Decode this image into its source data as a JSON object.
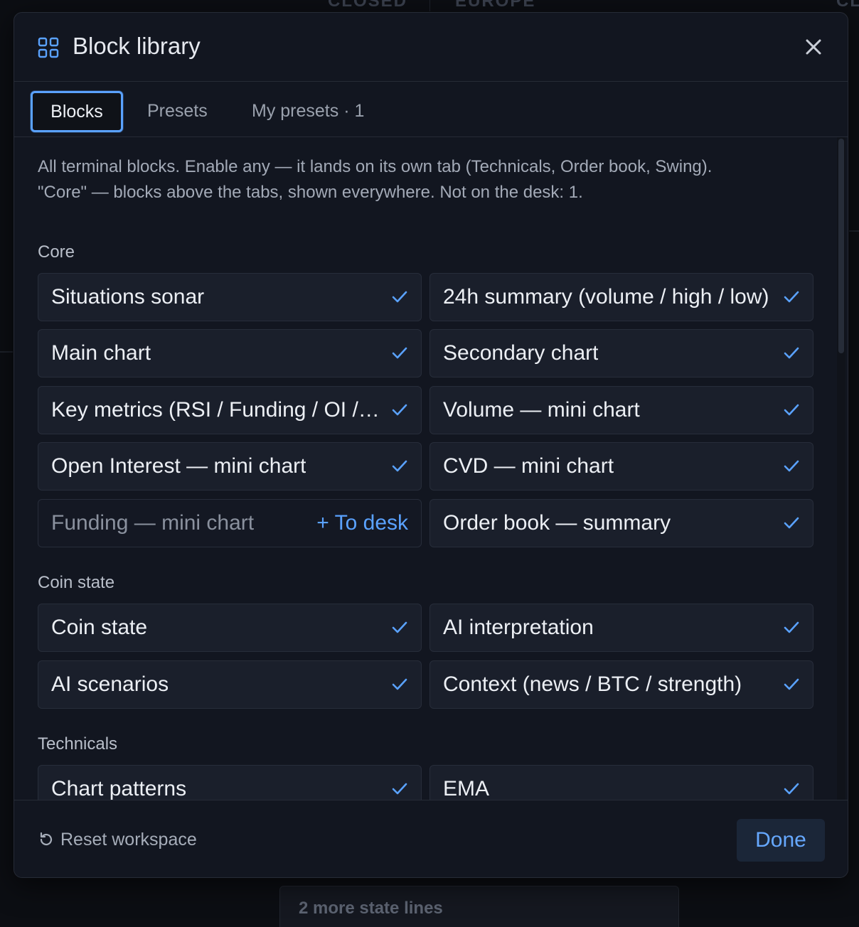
{
  "background": {
    "header_fragments": [
      "CLOSED",
      "EUROPE",
      "CL"
    ],
    "more_state_lines": "2 more state lines"
  },
  "modal": {
    "title": "Block library",
    "title_icon": "grid-icon",
    "close_icon": "close-icon",
    "tabs": [
      {
        "label": "Blocks",
        "active": true
      },
      {
        "label": "Presets",
        "active": false
      },
      {
        "label": "My presets · 1",
        "active": false
      }
    ],
    "description_line1": "All terminal blocks. Enable any — it lands on its own tab (Technicals, Order book, Swing).",
    "description_line2": "\"Core\" — blocks above the tabs, shown everywhere. Not on the desk: 1.",
    "sections": [
      {
        "title": "Core",
        "items": [
          {
            "label": "Situations sonar",
            "enabled": true
          },
          {
            "label": "24h summary (volume / high / low)",
            "enabled": true
          },
          {
            "label": "Main chart",
            "enabled": true
          },
          {
            "label": "Secondary chart",
            "enabled": true
          },
          {
            "label": "Key metrics (RSI / Funding / OI / ...)",
            "enabled": true
          },
          {
            "label": "Volume — mini chart",
            "enabled": true
          },
          {
            "label": "Open Interest — mini chart",
            "enabled": true
          },
          {
            "label": "CVD — mini chart",
            "enabled": true
          },
          {
            "label": "Funding — mini chart",
            "enabled": false,
            "action": "+ To desk"
          },
          {
            "label": "Order book — summary",
            "enabled": true
          }
        ]
      },
      {
        "title": "Coin state",
        "items": [
          {
            "label": "Coin state",
            "enabled": true
          },
          {
            "label": "AI interpretation",
            "enabled": true
          },
          {
            "label": "AI scenarios",
            "enabled": true
          },
          {
            "label": "Context (news / BTC / strength)",
            "enabled": true
          }
        ]
      },
      {
        "title": "Technicals",
        "items": [
          {
            "label": "Chart patterns",
            "enabled": true
          },
          {
            "label": "EMA",
            "enabled": true
          }
        ]
      }
    ],
    "footer": {
      "reset_label": "Reset workspace",
      "reset_icon": "reset-icon",
      "done_label": "Done"
    }
  },
  "colors": {
    "accent": "#5aa2ff",
    "modal_bg": "#121620",
    "card_bg": "#1a1f2b"
  }
}
